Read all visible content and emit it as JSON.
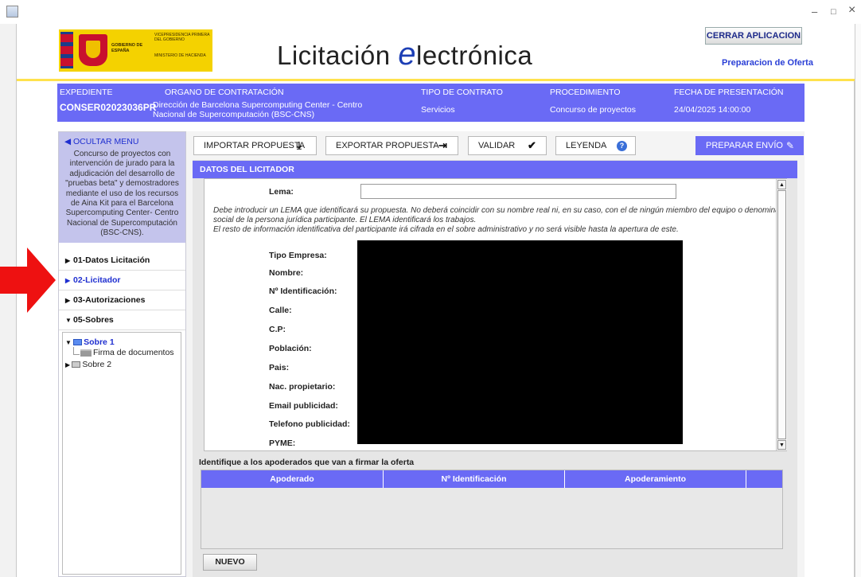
{
  "window": {
    "minimize": "–",
    "maximize": "□",
    "close": "×"
  },
  "header": {
    "gov_logo": {
      "gobierno": "GOBIERNO DE ESPAÑA",
      "vicepresidencia": "VICEPRESIDENCIA PRIMERA DEL GOBIERNO",
      "ministerio": "MINISTERIO DE HACIENDA"
    },
    "app_title_prefix": "Licitación ",
    "app_title_logo": "e",
    "app_title_suffix": "lectrónica",
    "close_button": "CERRAR APLICACION",
    "subtitle": "Preparacion de Oferta"
  },
  "infobar": {
    "expediente_label": "EXPEDIENTE",
    "expediente_value": "CONSER02023036PR",
    "organo_label": "ORGANO DE CONTRATACIÓN",
    "organo_value": "Dirección de Barcelona Supercomputing Center - Centro Nacional de Supercomputación (BSC-CNS)",
    "tipo_label": "TIPO DE CONTRATO",
    "tipo_value": "Servicios",
    "procedimiento_label": "PROCEDIMIENTO",
    "procedimiento_value": "Concurso de proyectos",
    "fecha_label": "FECHA DE PRESENTACIÓN",
    "fecha_value": "24/04/2025 14:00:00"
  },
  "sidebar": {
    "hide_menu": "OCULTAR MENU",
    "description": "Concurso de proyectos con intervención de jurado para la adjudicación del desarrollo de \"pruebas beta\" y demostradores mediante el uso de los recursos de Aina Kit para el Barcelona Supercomputing Center- Centro Nacional de Supercomputación (BSC-CNS).",
    "items": [
      {
        "label": "01-Datos Licitación"
      },
      {
        "label": "02-Licitador"
      },
      {
        "label": "03-Autorizaciones"
      },
      {
        "label": "05-Sobres"
      }
    ],
    "tree": {
      "sobre1": "Sobre 1",
      "firma": "Firma de documentos",
      "sobre2": "Sobre 2"
    }
  },
  "toolbar": {
    "importar": "IMPORTAR PROPUESTA",
    "exportar": "EXPORTAR PROPUESTA",
    "validar": "VALIDAR",
    "leyenda": "LEYENDA",
    "preparar": "PREPARAR ENVÍO"
  },
  "section": {
    "title": "DATOS DEL LICITADOR",
    "lema_label": "Lema:",
    "lema_value": "",
    "hint_line1": "Debe introducir un LEMA que identificará su propuesta. No deberá coincidir con su nombre real ni, en su caso, con el de ningún miembro del equipo o denominac",
    "hint_line2": "social de la persona jurídica participante. El LEMA identificará los trabajos.",
    "hint_line3": "El resto de información identificativa del participante irá cifrada en el sobre administrativo y no será visible hasta la apertura de este.",
    "fields": {
      "tipo_empresa": "Tipo Empresa:",
      "nombre": "Nombre:",
      "identificacion": "Nº Identificación:",
      "calle": "Calle:",
      "cp": "C.P:",
      "poblacion": "Población:",
      "pais": "Pais:",
      "nac_propietario": "Nac. propietario:",
      "email": "Email publicidad:",
      "telefono": "Telefono publicidad:",
      "pyme": "PYME:"
    }
  },
  "apoderados": {
    "title": "Identifique a los apoderados que van a firmar la oferta",
    "columns": [
      "Apoderado",
      "Nº Identificación",
      "Apoderamiento"
    ],
    "rows": [],
    "nuevo": "NUEVO"
  }
}
